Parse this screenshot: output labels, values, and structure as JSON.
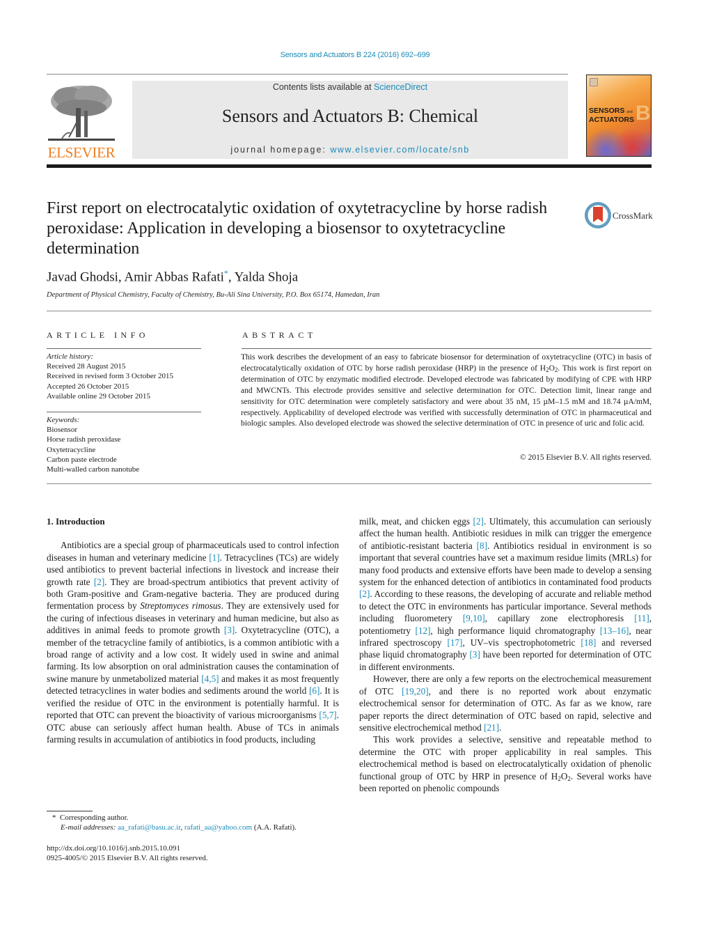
{
  "header": {
    "citation": "Sensors and Actuators B 224 (2016) 692–699",
    "contents_prefix": "Contents lists available at ",
    "contents_link": "ScienceDirect",
    "journal_title": "Sensors and Actuators B: Chemical",
    "homepage_prefix": "journal homepage: ",
    "homepage_link": "www.elsevier.com/locate/snb",
    "publisher_logo_text": "ELSEVIER",
    "cover": {
      "title_line1": "SENSORS",
      "title_and": "and",
      "title_line2": "ACTUATORS",
      "letter": "B"
    },
    "colors": {
      "link": "#1b8ab8",
      "elsevier_orange": "#f07f1e",
      "masthead_bg": "#e9e9e9"
    }
  },
  "article": {
    "title": "First report on electrocatalytic oxidation of oxytetracycline by horse radish peroxidase: Application in developing a biosensor to oxytetracycline determination",
    "crossmark_label": "CrossMark",
    "authors": {
      "before_star": "Javad Ghodsi, Amir Abbas Rafati",
      "star": "*",
      "after_star": ", Yalda Shoja"
    },
    "affiliation": "Department of Physical Chemistry, Faculty of Chemistry, Bu-Ali Sina University, P.O. Box 65174, Hamedan, Iran"
  },
  "article_info": {
    "heading": "ARTICLE INFO",
    "history_label": "Article history:",
    "history": [
      "Received 28 August 2015",
      "Received in revised form 3 October 2015",
      "Accepted 26 October 2015",
      "Available online 29 October 2015"
    ],
    "keywords_label": "Keywords:",
    "keywords": [
      "Biosensor",
      "Horse radish peroxidase",
      "Oxytetracycline",
      "Carbon paste electrode",
      "Multi-walled carbon nanotube"
    ]
  },
  "abstract": {
    "heading": "ABSTRACT",
    "text_part1": "This work describes the development of an easy to fabricate biosensor for determination of oxytetracycline (OTC) in basis of electrocatalytically oxidation of OTC by horse radish peroxidase (HRP) in the presence of H",
    "sub1": "2",
    "text_part2": "O",
    "sub2": "2",
    "text_part3": ". This work is first report on determination of OTC by enzymatic modified electrode. Developed electrode was fabricated by modifying of CPE with HRP and MWCNTs. This electrode provides sensitive and selective determination for OTC. Detection limit, linear range and sensitivity for OTC determination were completely satisfactory and were about 35 nM, 15 µM–1.5 mM and 18.74 µA/mM, respectively. Applicability of developed electrode was verified with successfully determination of OTC in pharmaceutical and biologic samples. Also developed electrode was showed the selective determination of OTC in presence of uric and folic acid.",
    "copyright": "© 2015 Elsevier B.V. All rights reserved."
  },
  "body": {
    "section_heading": "1.  Introduction",
    "p1": {
      "s1": "Antibiotics are a special group of pharmaceuticals used to control infection diseases in human and veterinary medicine ",
      "r1": "[1]",
      "s2": ". Tetracyclines (TCs) are widely used antibiotics to prevent bacterial infections in livestock and increase their growth rate ",
      "r2": "[2]",
      "s3": ". They are broad-spectrum antibiotics that prevent activity of both Gram-positive and Gram-negative bacteria. They are produced during fermentation process by ",
      "species": "Streptomyces rimosus",
      "s4": ". They are extensively used for the curing of infectious diseases in veterinary and human medicine, but also as additives in animal feeds to promote growth ",
      "r3": "[3]",
      "s5": ". Oxytetracycline (OTC), a member of the tetracycline family of antibiotics, is a common antibiotic with a broad range of activity and a low cost. It widely used in swine and animal farming. Its low absorption on oral administration causes the contamination of swine manure by unmetabolized material ",
      "r4": "[4,5]",
      "s6": " and makes it as most frequently detected tetracyclines in water bodies and sediments around the world ",
      "r5": "[6]",
      "s7": ". It is verified the residue of OTC in the environment is potentially harmful. It is reported that OTC can prevent the bioactivity of various microorganisms ",
      "r6": "[5,7]",
      "s8": ". OTC abuse can seriously affect human health. Abuse of TCs in animals farming results in accumulation of antibiotics in food products, including milk, meat, and chicken eggs ",
      "r7": "[2]",
      "s9": ". Ultimately, this accumulation can seriously affect the human health. Antibiotic residues in milk can trigger the emergence of antibiotic-resistant bacteria ",
      "r8": "[8]",
      "s10": ". Antibiotics residual in environment is so important that several countries have set a maximum residue limits (MRLs) for many food products and extensive efforts have been made to develop a sensing system for the enhanced detection of antibiotics in contaminated food products ",
      "r9": "[2]",
      "s11": ". According to these reasons, the developing of accurate and reliable method to detect the OTC in environments has particular importance. Several methods including fluorometery ",
      "r10": "[9,10]",
      "s12": ", capillary zone electrophoresis ",
      "r11": "[11]",
      "s13": ", potentiometry ",
      "r12": "[12]",
      "s14": ", high performance liquid chromatography ",
      "r13": "[13–16]",
      "s15": ", near infrared spectroscopy ",
      "r14": "[17]",
      "s16": ", UV–vis spectrophotometric ",
      "r15": "[18]",
      "s17": " and reversed phase liquid chromatography ",
      "r16": "[3]",
      "s18": " have been reported for determination of OTC in different environments."
    },
    "p2": {
      "s1": "However, there are only a few reports on the electrochemical measurement of OTC ",
      "r1": "[19,20]",
      "s2": ", and there is no reported work about enzymatic electrochemical sensor for determination of OTC. As far as we know, rare paper reports the direct determination of OTC based on rapid, selective and sensitive electrochemical method ",
      "r2": "[21]",
      "s3": "."
    },
    "p3": {
      "s1": "This work provides a selective, sensitive and repeatable method to determine the OTC with proper applicability in real samples. This electrochemical method is based on electrocatalytically oxidation of phenolic functional group of OTC by HRP in presence of H",
      "sub1": "2",
      "s2": "O",
      "sub2": "2",
      "s3": ". Several works have been reported on phenolic compounds"
    }
  },
  "footnotes": {
    "star": "*",
    "corresponding": "Corresponding author.",
    "email_label": "E-mail addresses:",
    "email1": "aa_rafati@basu.ac.ir",
    "email_sep": ", ",
    "email2": "rafati_aa@yahoo.com",
    "email_suffix": " (A.A. Rafati).",
    "doi": "http://dx.doi.org/10.1016/j.snb.2015.10.091",
    "issn": "0925-4005/© 2015 Elsevier B.V. All rights reserved."
  }
}
